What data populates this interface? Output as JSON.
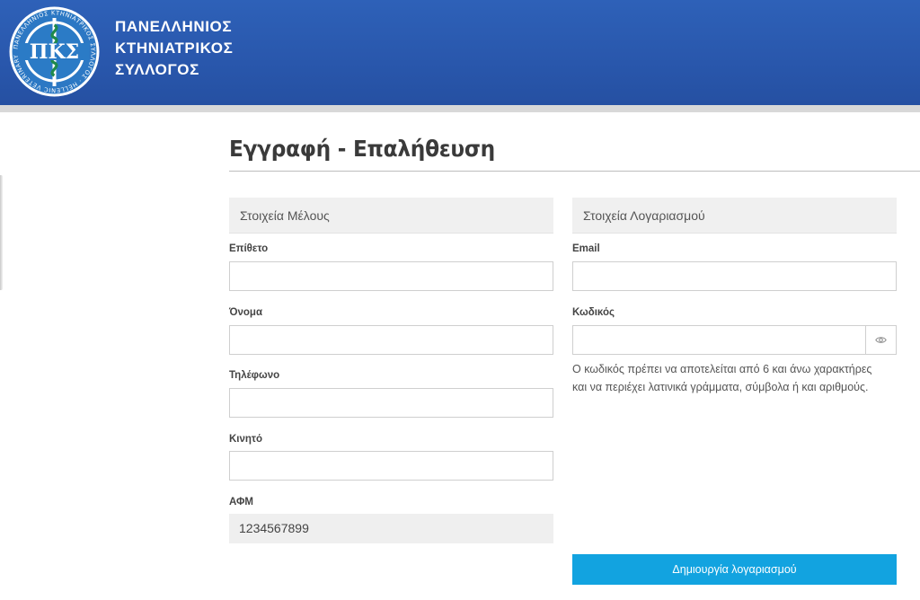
{
  "header": {
    "logo_letters": "ΠΚΣ",
    "logo_ring_text": "ΠΑΝΕΛΛΗΝΙΟΣ ΚΤΗΝΙΑΤΡΙΚΟΣ ΣΥΛΛΟΓΟΣ · HELLENIC VETERINARY ASSOCIATION",
    "brand_line1": "ΠΑΝΕΛΛΗΝΙΟΣ",
    "brand_line2": "ΚΤΗΝΙΑΤΡΙΚΟΣ",
    "brand_line3": "ΣΥΛΛΟΓΟΣ",
    "color": "#2a59ae"
  },
  "page": {
    "title": "Εγγραφή - Επαλήθευση"
  },
  "member": {
    "heading": "Στοιχεία Μέλους",
    "surname_label": "Επίθετο",
    "surname_value": "",
    "name_label": "Όνομα",
    "name_value": "",
    "phone_label": "Τηλέφωνο",
    "phone_value": "",
    "mobile_label": "Κινητό",
    "mobile_value": "",
    "afm_label": "ΑΦΜ",
    "afm_value": "1234567899"
  },
  "account": {
    "heading": "Στοιχεία Λογαριασμού",
    "email_label": "Email",
    "email_value": "",
    "password_label": "Κωδικός",
    "password_value": "",
    "password_toggle_icon": "eye-icon",
    "hint_line1": "Ο κωδικός πρέπει να αποτελείται από 6 και άνω χαρακτήρες",
    "hint_line2": "και να περιέχει λατινικά γράμματα, σύμβολα ή και αριθμούς.",
    "submit_label": "Δημιουργία λογαριασμού",
    "accent": "#12a3e0"
  }
}
